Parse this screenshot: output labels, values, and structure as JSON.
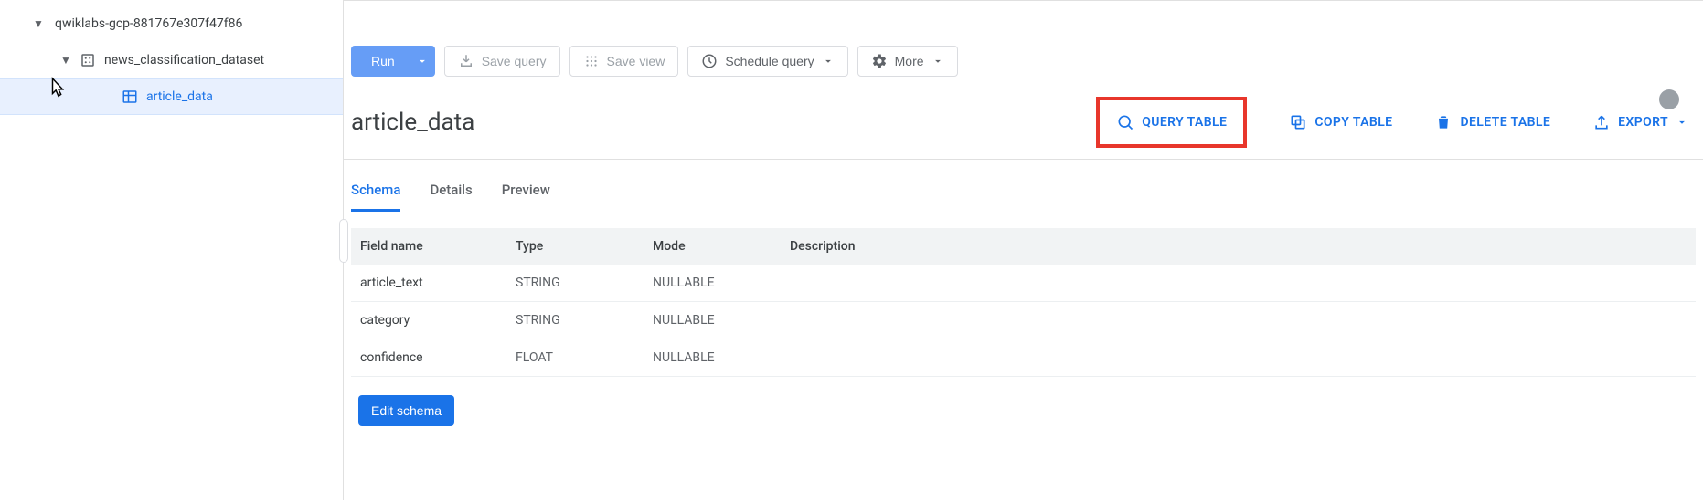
{
  "sidebar": {
    "items": [
      {
        "label": "qwiklabs-gcp-881767e307f47f86"
      },
      {
        "label": "news_classification_dataset"
      },
      {
        "label": "article_data"
      }
    ]
  },
  "toolbar": {
    "run_label": "Run",
    "save_query_label": "Save query",
    "save_view_label": "Save view",
    "schedule_label": "Schedule query",
    "more_label": "More"
  },
  "table_header": {
    "title": "article_data",
    "query_table_label": "QUERY TABLE",
    "copy_table_label": "COPY TABLE",
    "delete_table_label": "DELETE TABLE",
    "export_label": "EXPORT"
  },
  "tabs": [
    {
      "label": "Schema"
    },
    {
      "label": "Details"
    },
    {
      "label": "Preview"
    }
  ],
  "schema": {
    "headers": {
      "field": "Field name",
      "type": "Type",
      "mode": "Mode",
      "desc": "Description"
    },
    "rows": [
      {
        "field": "article_text",
        "type": "STRING",
        "mode": "NULLABLE",
        "desc": ""
      },
      {
        "field": "category",
        "type": "STRING",
        "mode": "NULLABLE",
        "desc": ""
      },
      {
        "field": "confidence",
        "type": "FLOAT",
        "mode": "NULLABLE",
        "desc": ""
      }
    ]
  },
  "edit_schema_label": "Edit schema"
}
